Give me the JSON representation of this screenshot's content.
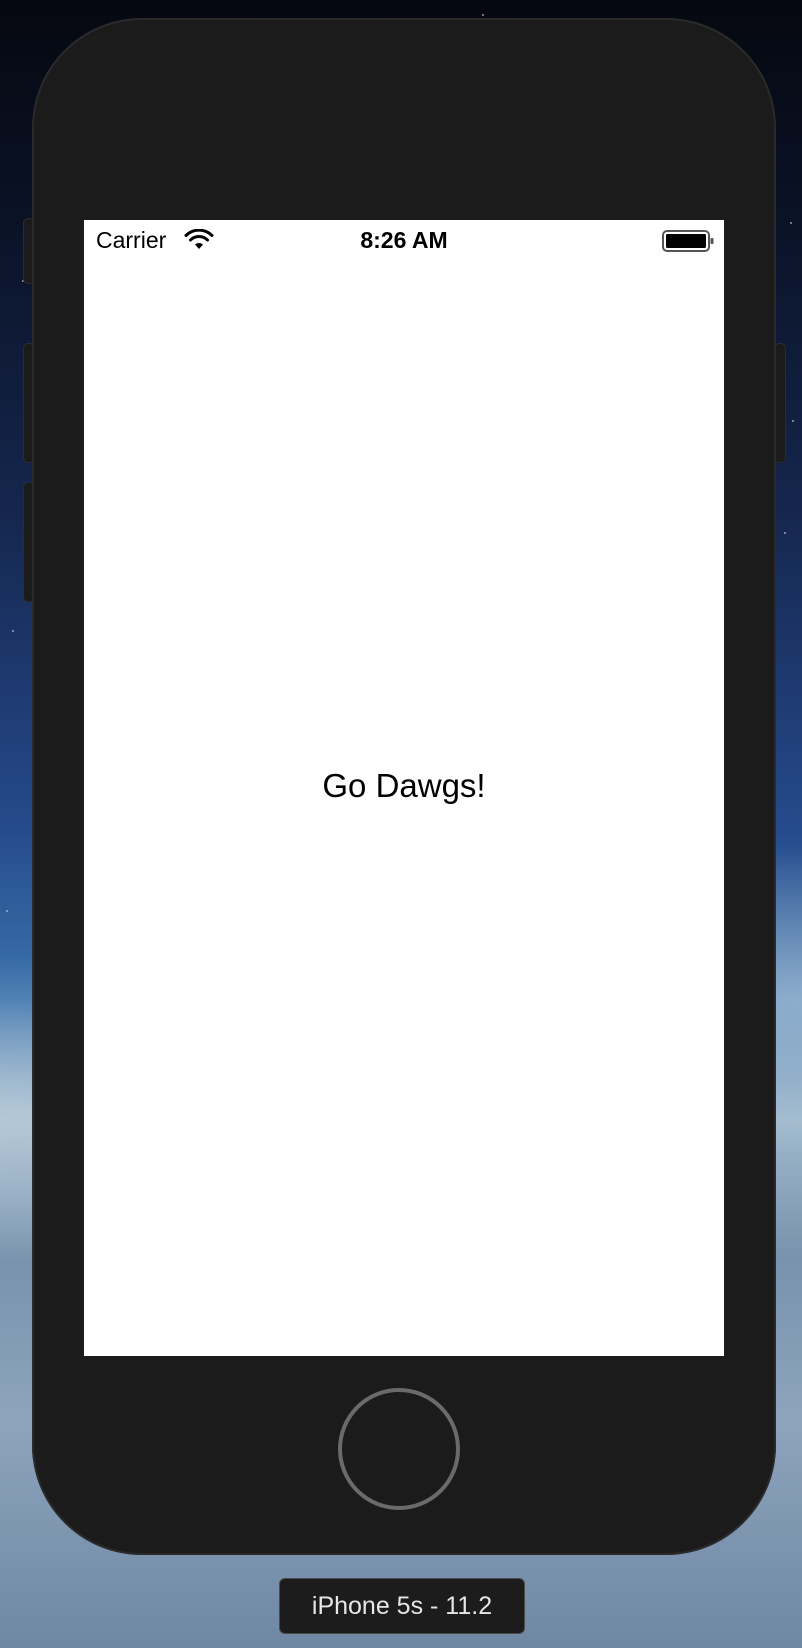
{
  "status_bar": {
    "carrier": "Carrier",
    "time": "8:26 AM",
    "wifi_icon": "wifi-icon",
    "battery_icon": "battery-icon",
    "battery_level": 1.0
  },
  "app": {
    "main_label": "Go Dawgs!",
    "background": "#ffffff"
  },
  "simulator": {
    "device_label": "iPhone 5s - 11.2",
    "home_button_icon": "home-button-circle",
    "bezel_color": "#1b1b1b"
  }
}
